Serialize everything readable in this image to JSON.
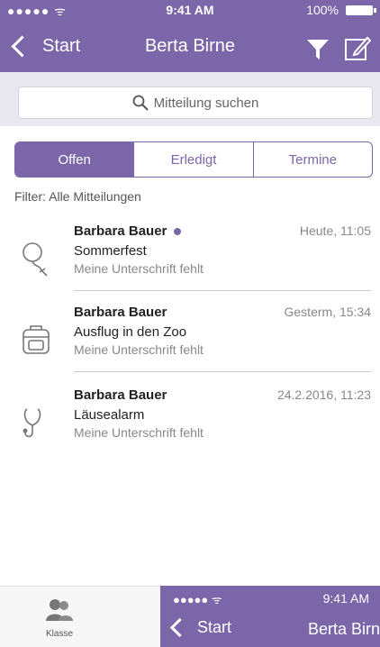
{
  "status_bar": {
    "signal": "●●●●● ᯤ",
    "time": "9:41 AM",
    "battery": "100%"
  },
  "nav": {
    "back_label": "Start",
    "title": "Berta Birne"
  },
  "search": {
    "placeholder": "Mitteilung suchen"
  },
  "segments": [
    "Offen",
    "Erledigt",
    "Termine"
  ],
  "filter_text": "Filter: Alle Mitteilungen",
  "messages": [
    {
      "sender": "Barbara Bauer",
      "subject": "Sommerfest",
      "note": "Meine Unterschrift fehlt",
      "date": "Heute, 11:05",
      "unread": true,
      "icon": "balloon-icon"
    },
    {
      "sender": "Barbara Bauer",
      "subject": "Ausflug in den Zoo",
      "note": "Meine Unterschrift fehlt",
      "date": "Gesterm, 15:34",
      "unread": false,
      "icon": "backpack-icon"
    },
    {
      "sender": "Barbara Bauer",
      "subject": "Läusealarm",
      "note": "Meine Unterschrift fehlt",
      "date": "24.2.2016, 11:23",
      "unread": false,
      "icon": "stethoscope-icon"
    }
  ],
  "tabbar": {
    "klasse_label": "Klasse"
  },
  "overlay": {
    "signal": "●●●●● ᯤ",
    "time": "9:41 AM",
    "back_label": "Start",
    "title": "Berta Birn"
  },
  "colors": {
    "accent": "#7a66a8",
    "search_bg": "#e9e7ef"
  }
}
